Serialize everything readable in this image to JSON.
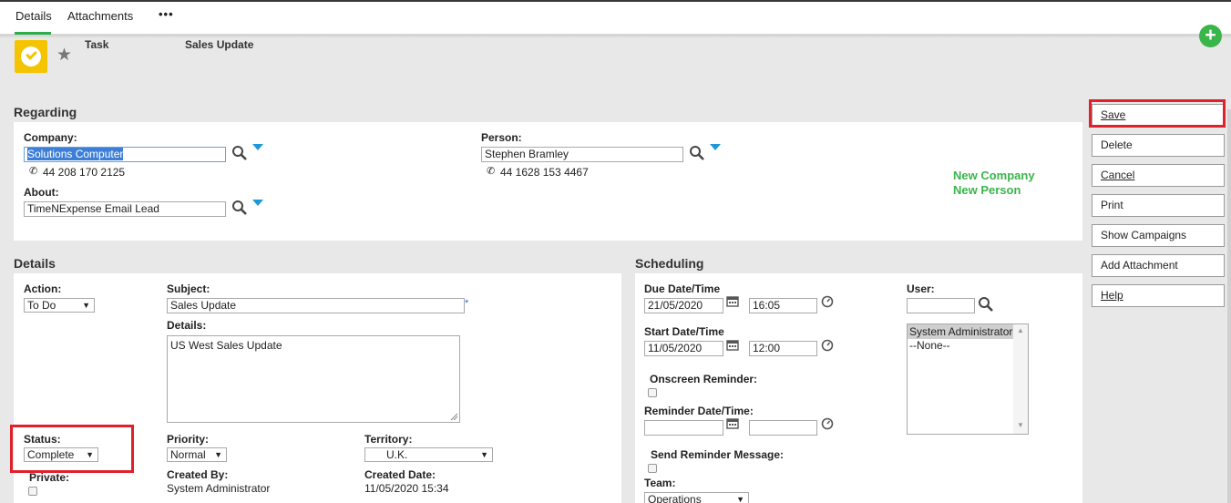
{
  "tabs": {
    "details": "Details",
    "attachments": "Attachments",
    "more": "•••"
  },
  "header": {
    "entity_label": "Task",
    "entity_name": "Sales Update"
  },
  "icons": {
    "task": "task-check-icon",
    "star": "star-icon",
    "add": "plus-icon",
    "search": "search-icon",
    "dropdown": "dropdown-arrow-icon",
    "phone": "phone-icon",
    "calendar": "calendar-icon",
    "clock": "clock-icon"
  },
  "colors": {
    "accent_green": "#3ab54a",
    "task_yellow": "#f5c400",
    "highlight_red": "#e0202b",
    "dropdown_blue": "#1e98d6"
  },
  "regarding": {
    "title": "Regarding",
    "company_label": "Company:",
    "company_value": "Solutions Computer",
    "company_phone": "44 208 170 2125",
    "about_label": "About:",
    "about_value": "TimeNExpense Email Lead",
    "person_label": "Person:",
    "person_value": "Stephen Bramley",
    "person_phone": "44 1628 153 4467",
    "new_company": "New Company",
    "new_person": "New Person"
  },
  "details": {
    "title": "Details",
    "action_label": "Action:",
    "action_value": "To Do",
    "subject_label": "Subject:",
    "subject_value": "Sales Update",
    "required_mark": "*",
    "details_label": "Details:",
    "details_value": "US West Sales Update",
    "status_label": "Status:",
    "status_value": "Complete",
    "private_label": "Private:",
    "priority_label": "Priority:",
    "priority_value": "Normal",
    "territory_label": "Territory:",
    "territory_value": "U.K.",
    "created_by_label": "Created By:",
    "created_by_value": "System Administrator",
    "created_date_label": "Created Date:",
    "created_date_value": "11/05/2020 15:34"
  },
  "scheduling": {
    "title": "Scheduling",
    "due_label": "Due Date/Time",
    "due_date": "21/05/2020",
    "due_time": "16:05",
    "start_label": "Start Date/Time",
    "start_date": "11/05/2020",
    "start_time": "12:00",
    "onscreen_label": "Onscreen Reminder:",
    "reminder_label": "Reminder Date/Time:",
    "reminder_date": "",
    "reminder_time": "",
    "send_reminder_label": "Send Reminder Message:",
    "team_label": "Team:",
    "team_value": "Operations",
    "user_label": "User:",
    "user_search": "",
    "user_options": [
      "System Administrator",
      "--None--"
    ]
  },
  "actions": {
    "save": "Save",
    "delete": "Delete",
    "cancel": "Cancel",
    "print": "Print",
    "show_campaigns": "Show Campaigns",
    "add_attachment": "Add Attachment",
    "help": "Help"
  }
}
